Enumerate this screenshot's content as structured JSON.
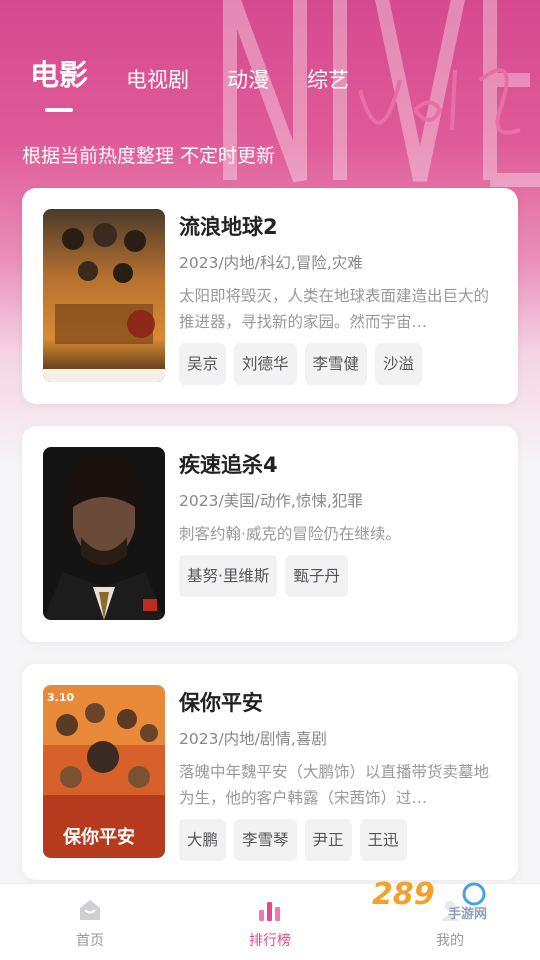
{
  "tabs": [
    {
      "label": "电影",
      "active": true
    },
    {
      "label": "电视剧",
      "active": false
    },
    {
      "label": "动漫",
      "active": false
    },
    {
      "label": "综艺",
      "active": false
    }
  ],
  "subtitle": "根据当前热度整理 不定时更新",
  "movies": [
    {
      "title": "流浪地球2",
      "meta": "2023/内地/科幻,冒险,灾难",
      "desc": "太阳即将毁灭，人类在地球表面建造出巨大的推进器，寻找新的家园。然而宇宙…",
      "actors": [
        "吴京",
        "刘德华",
        "李雪健",
        "沙溢"
      ]
    },
    {
      "title": "疾速追杀4",
      "meta": "2023/美国/动作,惊悚,犯罪",
      "desc": "刺客约翰·威克的冒险仍在继续。",
      "actors": [
        "基努·里维斯",
        "甄子丹"
      ]
    },
    {
      "title": "保你平安",
      "meta": "2023/内地/剧情,喜剧",
      "desc": "落魄中年魏平安（大鹏饰）以直播带货卖墓地为生，他的客户韩露（宋茜饰）过…",
      "actors": [
        "大鹏",
        "李雪琴",
        "尹正",
        "王迅"
      ],
      "poster_text": "保你平安",
      "poster_date": "3.10"
    }
  ],
  "nav": [
    {
      "label": "首页",
      "icon": "home-icon",
      "active": false
    },
    {
      "label": "排行榜",
      "icon": "ranking-icon",
      "active": true
    },
    {
      "label": "我的",
      "icon": "profile-icon",
      "active": false
    }
  ],
  "watermark": {
    "brand": "289",
    "sub": "手游网"
  },
  "colors": {
    "accent": "#e24c8f",
    "hero": "#d54a8e"
  }
}
